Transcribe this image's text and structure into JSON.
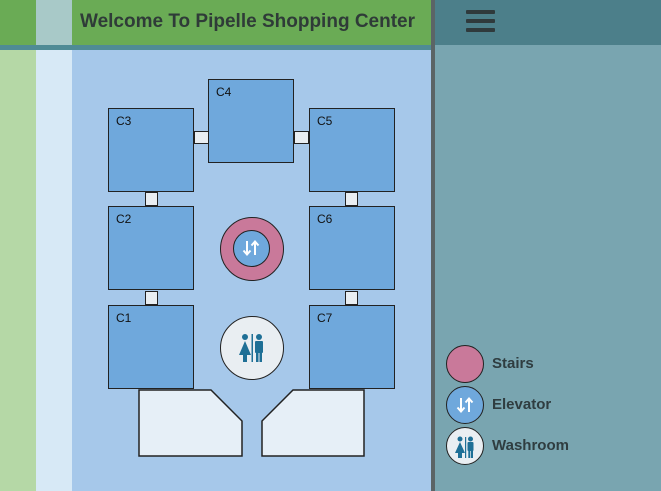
{
  "header": {
    "title": "Welcome To Pipelle Shopping Center"
  },
  "menu": {
    "icon": "hamburger-menu-icon"
  },
  "shops": [
    {
      "id": "C1",
      "label": "C1"
    },
    {
      "id": "C2",
      "label": "C2"
    },
    {
      "id": "C3",
      "label": "C3"
    },
    {
      "id": "C4",
      "label": "C4"
    },
    {
      "id": "C5",
      "label": "C5"
    },
    {
      "id": "C6",
      "label": "C6"
    },
    {
      "id": "C7",
      "label": "C7"
    }
  ],
  "legend": {
    "stairs": {
      "label": "Stairs",
      "color": "#c9799a"
    },
    "elevator": {
      "label": "Elevator",
      "color": "#6fa8dc"
    },
    "washroom": {
      "label": "Washroom",
      "color": "#e9eef2"
    }
  },
  "colors": {
    "header": "#6aab55",
    "map": "#a6c8ea",
    "shop": "#6fa8dc",
    "panel": "#79a5b0",
    "panel_header": "#4c7f8a",
    "icon": "#1e6f96"
  }
}
